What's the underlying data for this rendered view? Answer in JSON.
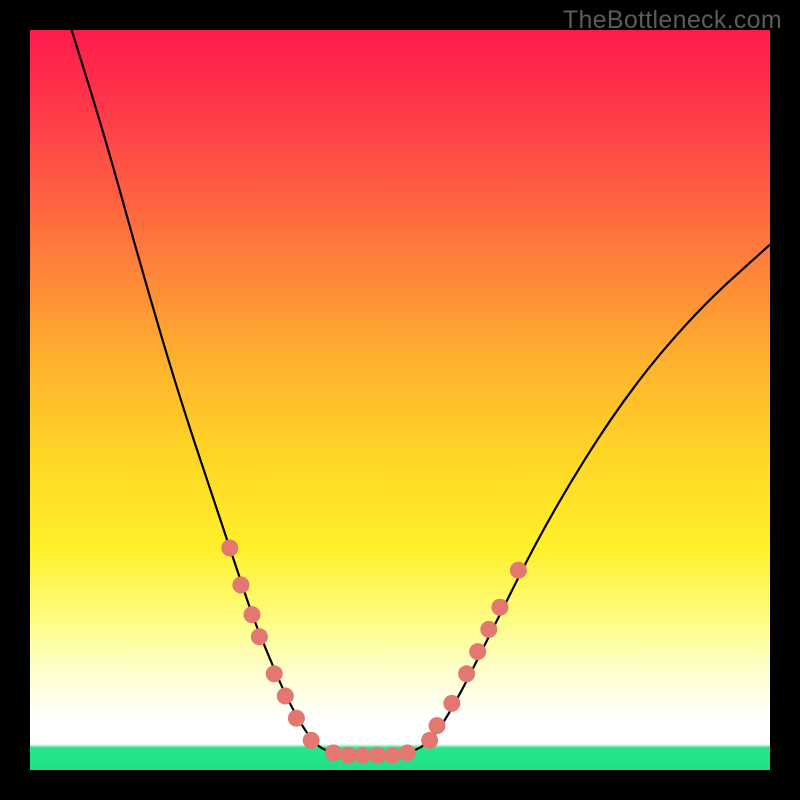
{
  "watermark": "TheBottleneck.com",
  "colors": {
    "gradient_stops": [
      "#ff1a4c",
      "#ff3d48",
      "#ff7b3b",
      "#ffb22e",
      "#ffd726",
      "#fff02a",
      "#fffd86",
      "#ffffd0",
      "#ffffff",
      "#27e68a"
    ],
    "curve_stroke": "#000000",
    "marker_fill": "#e2786f",
    "page_bg": "#000000"
  },
  "chart_data": {
    "type": "line",
    "title": "",
    "xlabel": "",
    "ylabel": "",
    "xlim": [
      0,
      100
    ],
    "ylim": [
      0,
      100
    ],
    "grid": false,
    "legend": false,
    "_note": "Axes unlabeled in source image; values are % of plot area, y=0 at bottom. Curve is a V-shaped bottleneck profile with a flat trough near x≈40–50.",
    "series": [
      {
        "name": "bottleneck-curve",
        "x": [
          5,
          10,
          15,
          20,
          25,
          28,
          30,
          32,
          35,
          38,
          40,
          43,
          46,
          50,
          53,
          55,
          58,
          62,
          70,
          80,
          90,
          100
        ],
        "y": [
          102,
          86,
          68,
          51,
          36,
          27,
          21,
          16,
          9,
          4,
          2.5,
          2,
          2,
          2,
          3,
          5,
          10,
          18,
          34,
          50,
          62,
          71
        ]
      }
    ],
    "markers": {
      "name": "highlighted-points",
      "points": [
        {
          "x": 27,
          "y": 30
        },
        {
          "x": 28.5,
          "y": 25
        },
        {
          "x": 30,
          "y": 21
        },
        {
          "x": 31,
          "y": 18
        },
        {
          "x": 33,
          "y": 13
        },
        {
          "x": 34.5,
          "y": 10
        },
        {
          "x": 36,
          "y": 7
        },
        {
          "x": 38,
          "y": 4
        },
        {
          "x": 41,
          "y": 2.3
        },
        {
          "x": 43,
          "y": 2
        },
        {
          "x": 45,
          "y": 2
        },
        {
          "x": 47,
          "y": 2
        },
        {
          "x": 49,
          "y": 2
        },
        {
          "x": 51,
          "y": 2.3
        },
        {
          "x": 54,
          "y": 4
        },
        {
          "x": 55,
          "y": 6
        },
        {
          "x": 57,
          "y": 9
        },
        {
          "x": 59,
          "y": 13
        },
        {
          "x": 60.5,
          "y": 16
        },
        {
          "x": 62,
          "y": 19
        },
        {
          "x": 63.5,
          "y": 22
        },
        {
          "x": 66,
          "y": 27
        }
      ]
    }
  }
}
